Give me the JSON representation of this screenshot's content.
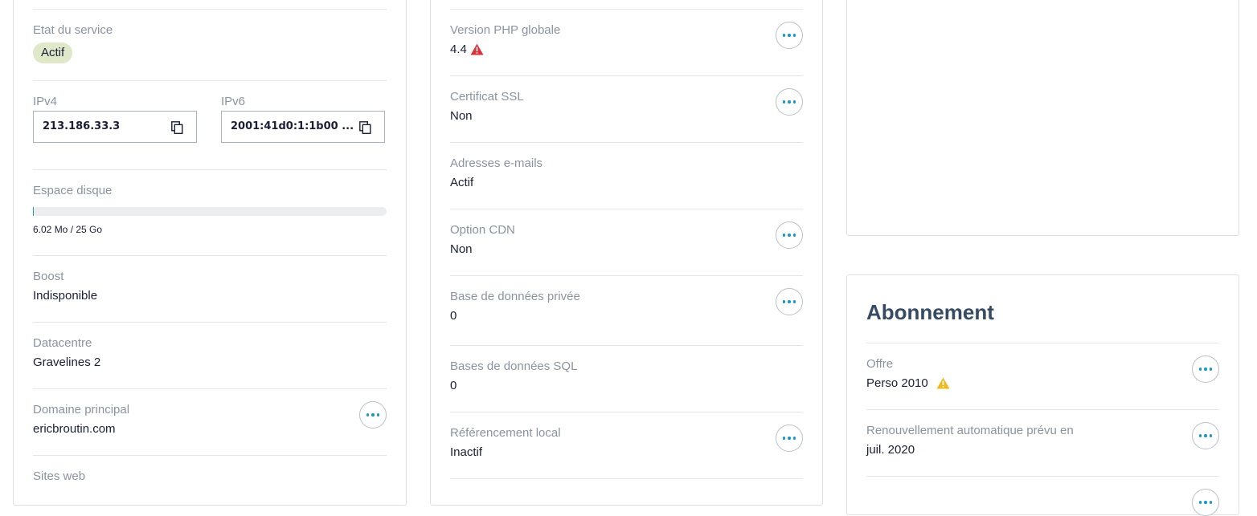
{
  "service": {
    "state_label": "Etat du service",
    "state_value": "Actif",
    "ipv4_label": "IPv4",
    "ipv4_value": "213.186.33.3",
    "ipv6_label": "IPv6",
    "ipv6_value": "2001:41d0:1:1b00 ...",
    "disk_label": "Espace disque",
    "disk_usage_text": "6.02 Mo / 25 Go",
    "disk_usage_fraction": 0.0002,
    "boost_label": "Boost",
    "boost_value": "Indisponible",
    "datacenter_label": "Datacentre",
    "datacenter_value": "Gravelines 2",
    "domain_label": "Domaine principal",
    "domain_value": "ericbroutin.com",
    "websites_label": "Sites web"
  },
  "config": {
    "php_label": "Version PHP globale",
    "php_value": "4.4",
    "ssl_label": "Certificat SSL",
    "ssl_value": "Non",
    "emails_label": "Adresses e-mails",
    "emails_value": "Actif",
    "cdn_label": "Option CDN",
    "cdn_value": "Non",
    "private_db_label": "Base de données privée",
    "private_db_value": "0",
    "sql_db_label": "Bases de données SQL",
    "sql_db_value": "0",
    "local_seo_label": "Référencement local",
    "local_seo_value": "Inactif"
  },
  "subscription": {
    "title": "Abonnement",
    "offer_label": "Offre",
    "offer_value": "Perso 2010",
    "renewal_label": "Renouvellement automatique prévu en",
    "renewal_value": "juil. 2020"
  },
  "icons": {
    "error": "warning-red-icon",
    "warning": "warning-yellow-icon",
    "copy": "copy-icon",
    "more": "ellipsis-icon"
  },
  "colors": {
    "accent": "#1a98c6",
    "badge_bg": "#dfe8c8",
    "error": "#d9343b",
    "warning": "#f0b81d",
    "title": "#364a63"
  }
}
